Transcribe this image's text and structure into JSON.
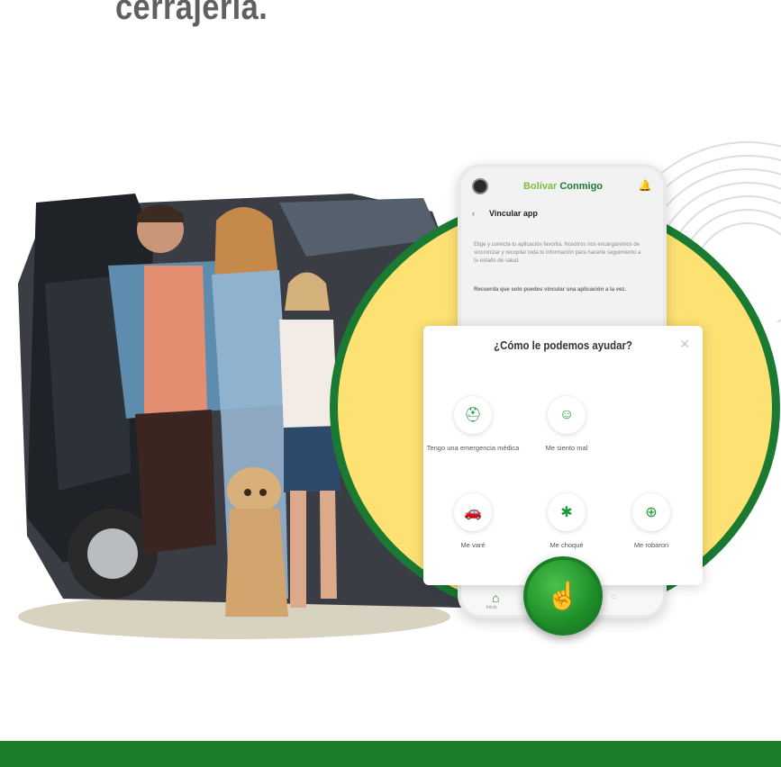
{
  "headline": "cerrajería.",
  "phone": {
    "brand_part1": "Bolívar",
    "brand_part2": "Conmigo",
    "screen_title": "Vincular app",
    "paragraph1": "Elige y conecta tu aplicación favorita. Nosotros nos encargaremos de sincronizar y recopilar toda tu información para hacerte seguimiento a tu estado de salud.",
    "paragraph2": "Recuerda que solo puedes vincular una aplicación a la vez.",
    "nav_home_label": "Inicio"
  },
  "help_modal": {
    "title": "¿Cómo le podemos ayudar?",
    "options": [
      {
        "label": "Tengo una emergencia médica",
        "icon": "ambulance-icon"
      },
      {
        "label": "Me siento mal",
        "icon": "sick-person-icon"
      },
      {
        "label": "Me varé",
        "icon": "broken-car-icon"
      },
      {
        "label": "Me choqué",
        "icon": "crash-icon"
      },
      {
        "label": "Me robaron",
        "icon": "theft-icon"
      }
    ]
  },
  "colors": {
    "brand_green": "#1b7f2a",
    "light_green": "#7cbf3f",
    "circle_yellow": "#fde173",
    "headline_gray": "#606060"
  }
}
